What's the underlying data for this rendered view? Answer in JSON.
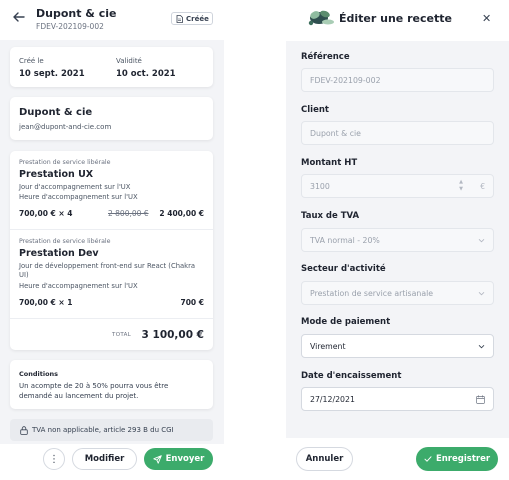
{
  "left": {
    "header": {
      "title": "Dupont & cie",
      "subtitle": "FDEV-202109-002",
      "badge": "Créée"
    },
    "dates": {
      "created_label": "Créé le",
      "created_value": "10 sept. 2021",
      "validity_label": "Validité",
      "validity_value": "10 oct. 2021"
    },
    "client": {
      "name": "Dupont & cie",
      "email": "jean@dupont-and-cie.com"
    },
    "items": [
      {
        "type": "Prestation de service libérale",
        "title": "Prestation UX",
        "desc": [
          "Jour d'accompagnement sur l'UX",
          "Heure d'accompagnement sur l'UX"
        ],
        "qty": "700,00 € × 4",
        "old": "2 800,00 €",
        "total": "2 400,00 €"
      },
      {
        "type": "Prestation de service libérale",
        "title": "Prestation Dev",
        "desc": [
          "Jour de développement front-end sur React (Chakra UI)",
          "Heure d'accompagnement sur l'UX"
        ],
        "qty": "700,00 € × 1",
        "old": "",
        "total": "700 €"
      }
    ],
    "total_label": "TOTAL",
    "total_value": "3 100,00 €",
    "conditions": {
      "title": "Conditions",
      "text": "Un acompte de 20 à 50% pourra vous être demandé au lancement du projet."
    },
    "tva_note": "TVA non applicable, article 293 B du CGI",
    "footer": {
      "more": "⋮",
      "modify": "Modifier",
      "send": "Envoyer"
    }
  },
  "right": {
    "title": "Éditer une recette",
    "fields": {
      "reference": {
        "label": "Référence",
        "value": "FDEV-202109-002"
      },
      "client": {
        "label": "Client",
        "value": "Dupont & cie"
      },
      "amount": {
        "label": "Montant HT",
        "value": "3100",
        "unit": "€"
      },
      "tva": {
        "label": "Taux de TVA",
        "value": "TVA normal - 20%"
      },
      "sector": {
        "label": "Secteur d'activité",
        "value": "Prestation de service artisanale"
      },
      "payment": {
        "label": "Mode de paiement",
        "value": "Virement"
      },
      "date": {
        "label": "Date d'encaissement",
        "value": "27/12/2021"
      }
    },
    "footer": {
      "cancel": "Annuler",
      "save": "Enregistrer"
    }
  },
  "colors": {
    "accent_green": "#3cab6b",
    "panel_bg": "#f3f4f7",
    "text_dark": "#1f2430"
  }
}
